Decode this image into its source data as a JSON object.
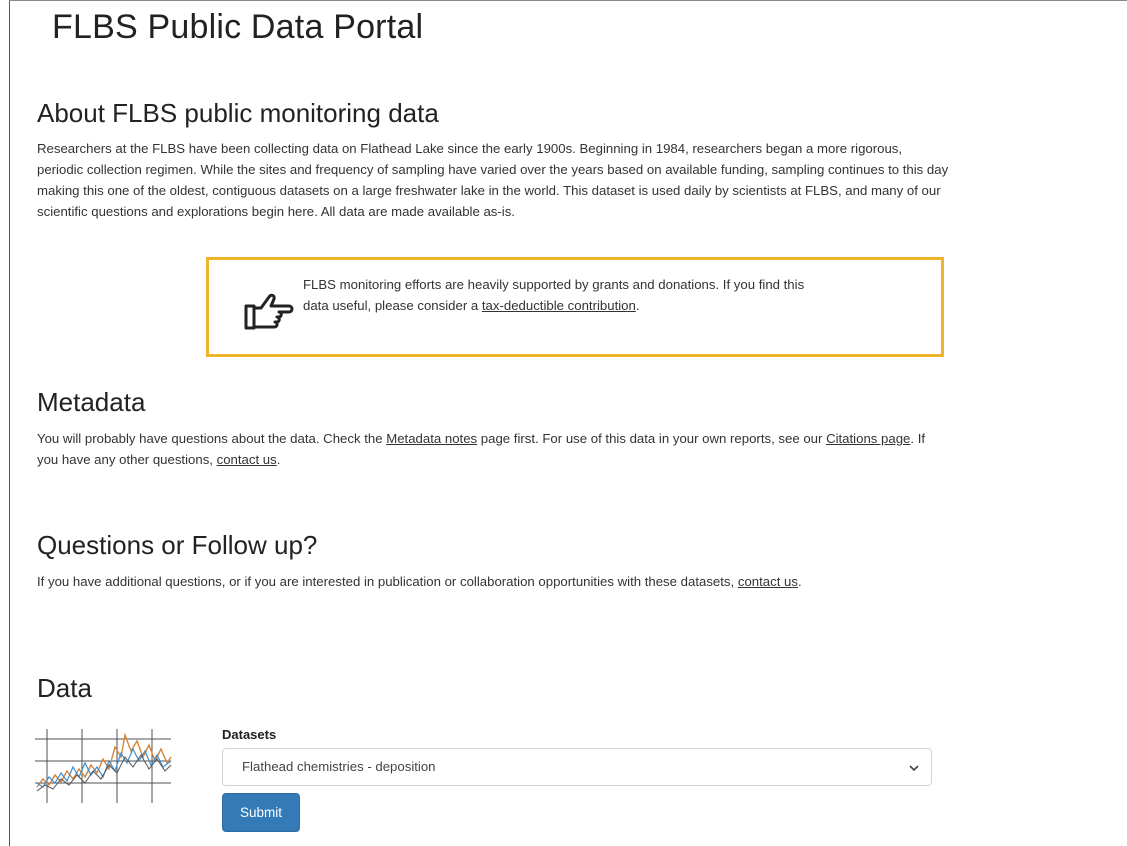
{
  "header": {
    "title": "FLBS Public Data Portal"
  },
  "about": {
    "heading": "About FLBS public monitoring data",
    "line1": "Researchers at the FLBS have been collecting data on Flathead Lake since the early 1900s. Beginning in 1984, researchers began a more rigorous,",
    "line2": "periodic collection regimen. While the sites and frequency of sampling have varied over the years based on available funding, sampling continues to this day",
    "line3": "making this one of the oldest, contiguous datasets on a large freshwater lake in the world. This dataset is used daily by scientists at FLBS, and many of our",
    "line4": "scientific questions and explorations begin here. All data are made available as-is."
  },
  "callout": {
    "icon": "pointing-hand-icon",
    "border_color": "#f0b429",
    "line1": "FLBS monitoring efforts are heavily supported by grants and donations. If you find this",
    "line2_prefix": "data useful, please consider a ",
    "link_text": "tax-deductible contribution",
    "line2_suffix": "."
  },
  "metadata": {
    "heading": "Metadata",
    "text1": "You will probably have questions about the data. Check the ",
    "link1": "Metadata notes",
    "text2": " page first. For use of this data in your own reports, see our ",
    "link2": "Citations page",
    "text3": ".  If",
    "text4": "you have any other questions, ",
    "link3": "contact us",
    "text5": "."
  },
  "questions": {
    "heading": "Questions or Follow up?",
    "text1": "If you have additional questions, or if you are interested in publication or collaboration opportunities with these datasets, ",
    "link": "contact us",
    "text2": "."
  },
  "data_section": {
    "heading": "Data",
    "thumbnail_icon": "timeseries-thumbnail-icon",
    "datasets_label": "Datasets",
    "selected_dataset": "Flathead chemistries - deposition",
    "submit_label": "Submit",
    "button_color": "#337ab7"
  }
}
